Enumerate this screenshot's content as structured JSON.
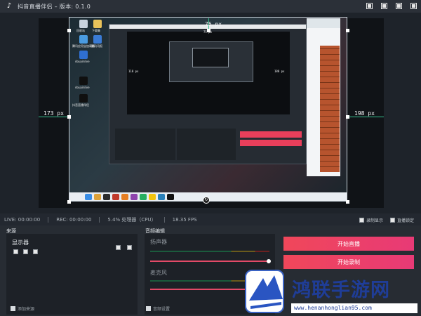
{
  "window": {
    "title": "抖音直播伴侣 – 版本: 0.1.0",
    "logo_icon": "douyin-logo-icon"
  },
  "preview": {
    "top_offset": "75 px",
    "left_offset": "173 px",
    "right_offset": "198 px",
    "inner_right_offset": "180 px",
    "inner_left_offset": "110 px",
    "inner_top_offset": "75 px",
    "desktop_icons": [
      "回收站",
      "下载集",
      "腾讯应用宝加载器",
      "腾讯讯报",
      "douyinlive",
      "douyinlive",
      "抖音直播伴侣"
    ]
  },
  "status": {
    "live": "LIVE: 00:00:00",
    "rec": "REC: 00:00:00",
    "cpu": "5.4% 处理器（CPU）",
    "fps": "18.35 FPS",
    "record_display_label": "录制显示",
    "scene_lock_label": "直播锁定"
  },
  "sources": {
    "title": "来源",
    "items": [
      {
        "name": "显示器"
      }
    ],
    "add_label": "添加来源"
  },
  "audio": {
    "title": "音频编辑",
    "speaker_label": "扬声器",
    "mic_label": "麦克风",
    "settings_label": "音频设置"
  },
  "actions": {
    "start_live": "开始直播",
    "start_record": "开始录制"
  },
  "watermark": {
    "name": "鸿联手游网",
    "url": "www.henanhonglian95.com"
  },
  "colors": {
    "accent": "#e83f5b",
    "guide": "#35c08f",
    "watermark_blue": "#1f3d97"
  }
}
